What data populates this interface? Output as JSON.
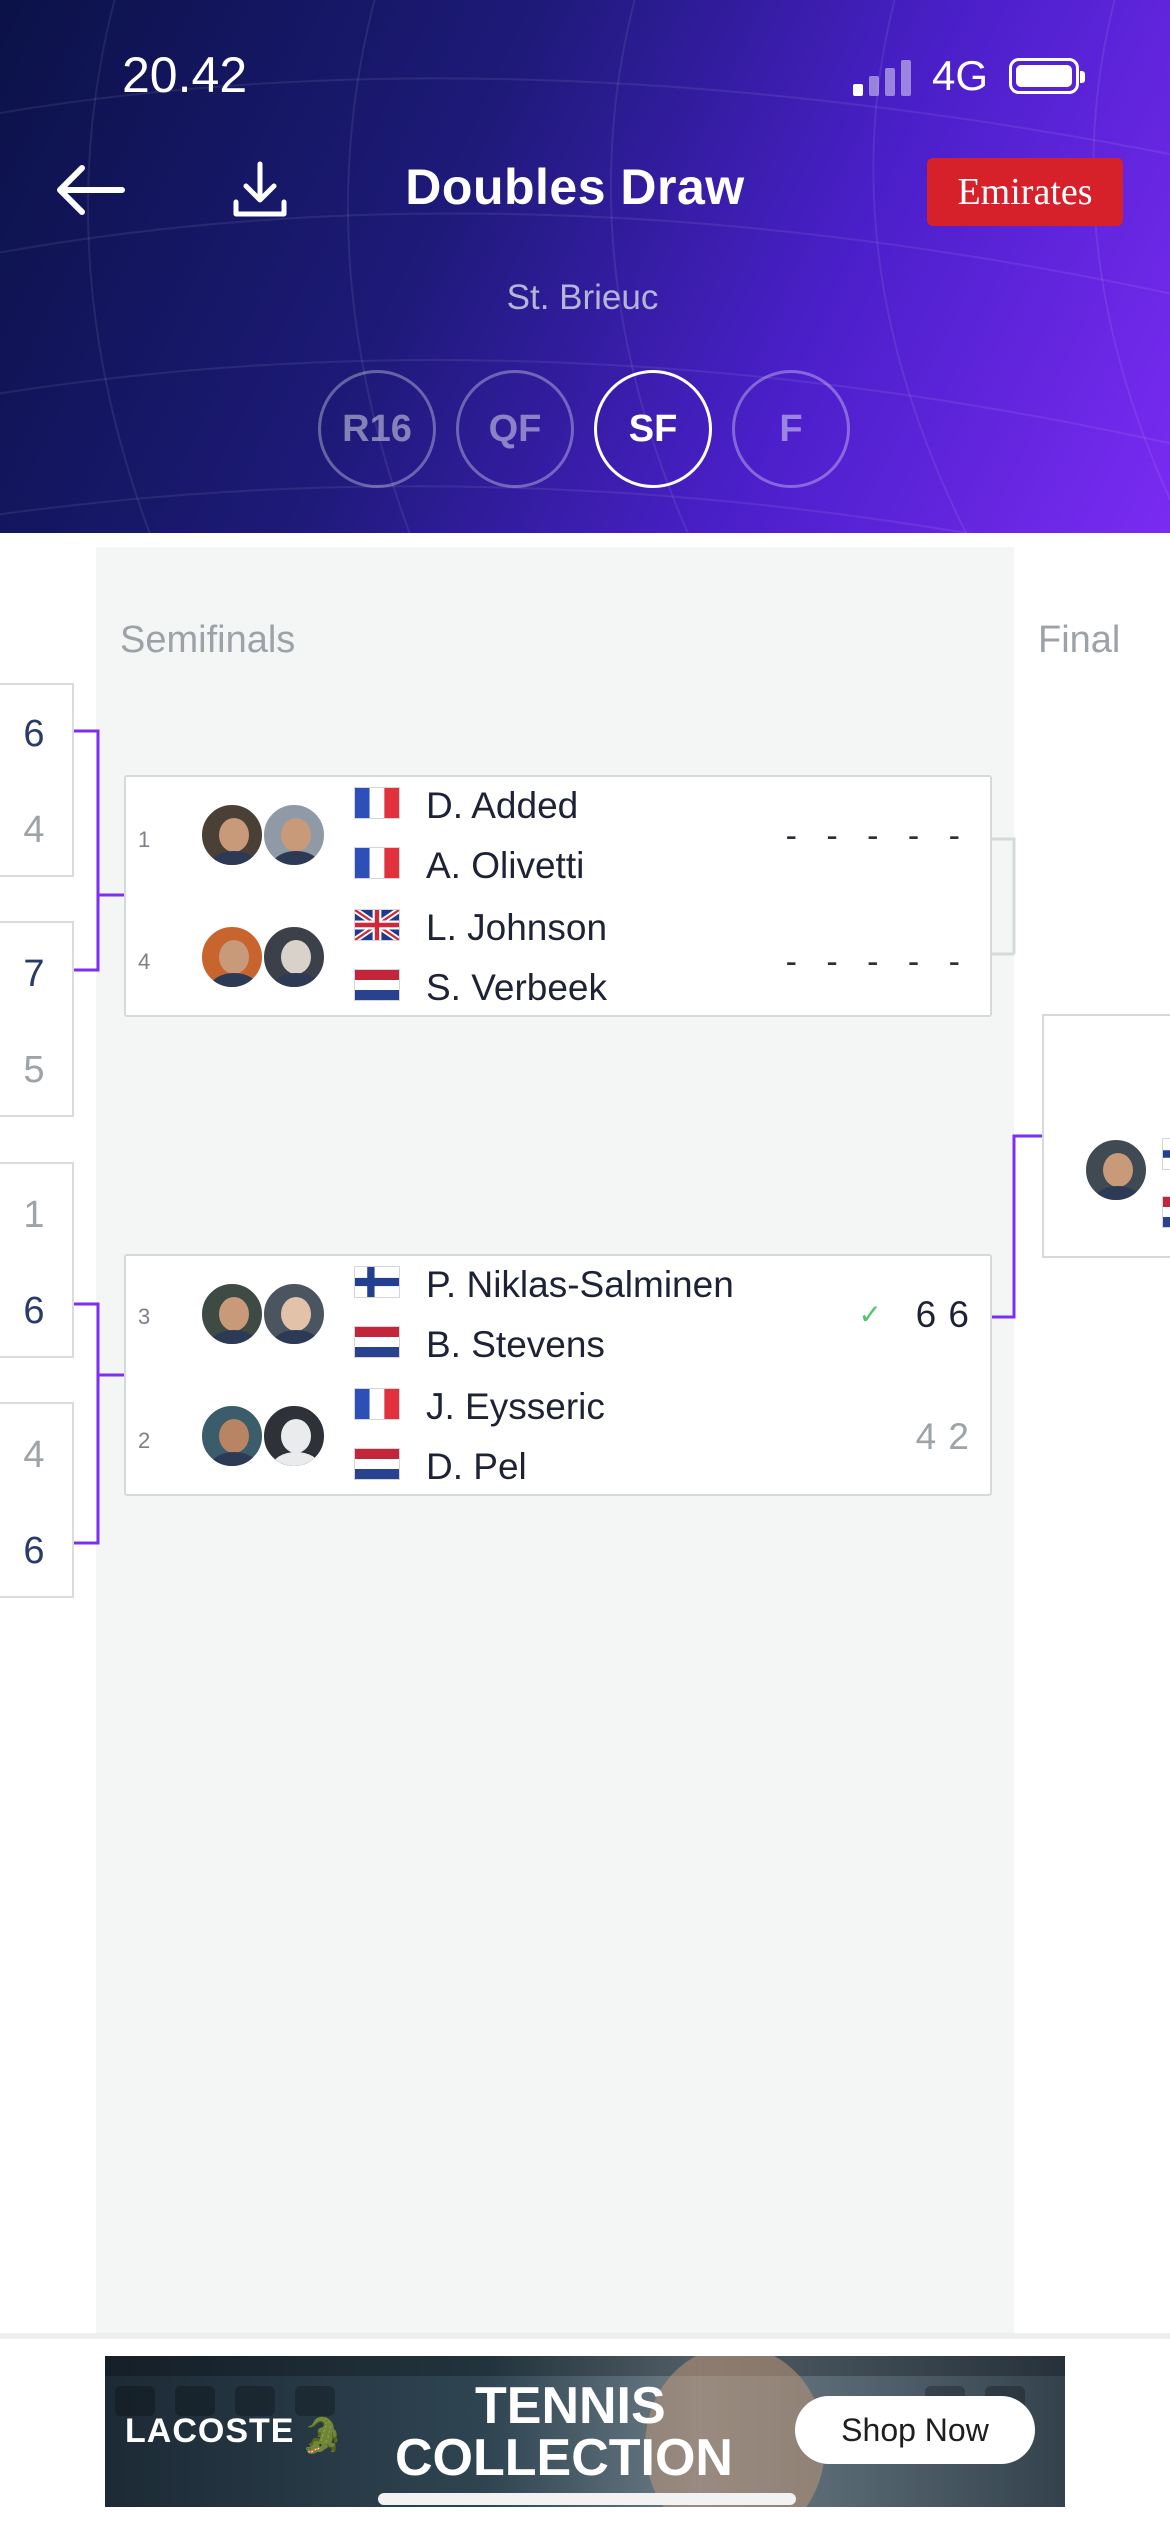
{
  "status_bar": {
    "time": "20.42",
    "network": "4G"
  },
  "header": {
    "title": "Doubles Draw",
    "subtitle": "St. Brieuc",
    "sponsor": "Emirates",
    "back_icon": "arrow-left-icon",
    "download_icon": "download-icon",
    "rounds": [
      {
        "label": "R16",
        "active": false
      },
      {
        "label": "QF",
        "active": false
      },
      {
        "label": "SF",
        "active": true
      },
      {
        "label": "F",
        "active": false
      }
    ]
  },
  "columns": {
    "current": "Semifinals",
    "next": "Final"
  },
  "previous_round_scores": [
    "6",
    "4",
    "7",
    "5",
    "1",
    "6",
    "4",
    "6"
  ],
  "semifinals": [
    {
      "teams": [
        {
          "seed": "1",
          "players": [
            "D. Added",
            "A. Olivetti"
          ],
          "flags": [
            "France",
            "France"
          ],
          "score": "- - - - -"
        },
        {
          "seed": "4",
          "players": [
            "L. Johnson",
            "S. Verbeek"
          ],
          "flags": [
            "United Kingdom",
            "Netherlands"
          ],
          "score": "- - - - -"
        }
      ]
    },
    {
      "teams": [
        {
          "seed": "3",
          "players": [
            "P. Niklas-Salminen",
            "B. Stevens"
          ],
          "flags": [
            "Finland",
            "Netherlands"
          ],
          "score": "6 6",
          "winner": true
        },
        {
          "seed": "2",
          "players": [
            "J. Eysseric",
            "D. Pel"
          ],
          "flags": [
            "France",
            "Netherlands"
          ],
          "score": "4 2",
          "winner": false
        }
      ]
    }
  ],
  "ad": {
    "brand": "LACOSTE",
    "headline_line1": "TENNIS",
    "headline_line2": "COLLECTION",
    "cta": "Shop Now"
  },
  "colors": {
    "accent": "#7b2ff2",
    "sponsor_red": "#d6202a",
    "win_check": "#53c56c"
  }
}
